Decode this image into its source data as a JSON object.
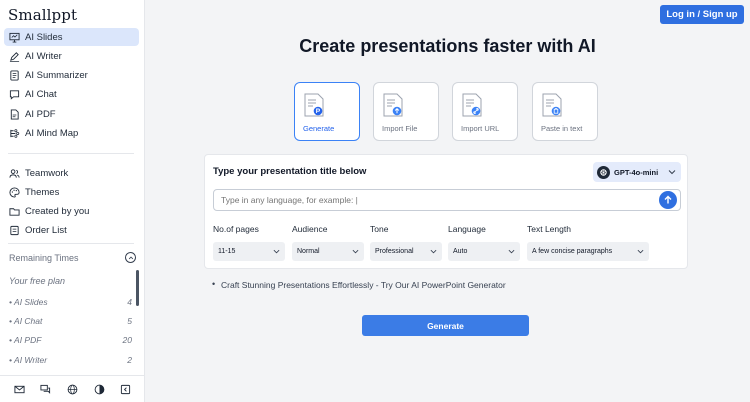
{
  "sidebar": {
    "logo": "Smallppt",
    "nav": [
      {
        "label": "AI Slides",
        "icon": "presentation-icon",
        "active": true
      },
      {
        "label": "AI Writer",
        "icon": "pen-icon"
      },
      {
        "label": "AI Summarizer",
        "icon": "document-icon"
      },
      {
        "label": "AI Chat",
        "icon": "chat-icon"
      },
      {
        "label": "AI PDF",
        "icon": "pdf-icon"
      },
      {
        "label": "AI Mind Map",
        "icon": "mindmap-icon"
      }
    ],
    "nav2": [
      {
        "label": "Teamwork",
        "icon": "team-icon"
      },
      {
        "label": "Themes",
        "icon": "palette-icon"
      },
      {
        "label": "Created by you",
        "icon": "folder-icon"
      },
      {
        "label": "Order List",
        "icon": "receipt-icon"
      }
    ],
    "remaining_label": "Remaining Times",
    "free_plan": "Your free plan",
    "quotas": [
      {
        "label": "• AI Slides",
        "count": "4"
      },
      {
        "label": "• AI Chat",
        "count": "5"
      },
      {
        "label": "• AI PDF",
        "count": "20"
      },
      {
        "label": "• AI Writer",
        "count": "2"
      }
    ],
    "bottom_icons": [
      "mail-icon",
      "chat-bubbles-icon",
      "globe-icon",
      "contrast-icon",
      "collapse-sidebar-icon"
    ]
  },
  "header": {
    "login_label": "Log in / Sign up"
  },
  "main": {
    "headline": "Create presentations faster with AI",
    "modes": [
      {
        "label": "Generate",
        "active": true,
        "badge_color": "#2563eb"
      },
      {
        "label": "Import File",
        "badge_color": "#3b82f6"
      },
      {
        "label": "Import URL",
        "badge_color": "#3b82f6"
      },
      {
        "label": "Paste in text",
        "badge_color": "#3b82f6"
      }
    ],
    "panel": {
      "title": "Type your presentation title below",
      "model": "GPT-4o-mini",
      "input_placeholder": "Type in any language, for example: |",
      "options": [
        {
          "label": "No.of pages",
          "value": "11-15"
        },
        {
          "label": "Audience",
          "value": "Normal"
        },
        {
          "label": "Tone",
          "value": "Professional"
        },
        {
          "label": "Language",
          "value": "Auto"
        },
        {
          "label": "Text Length",
          "value": "A few concise paragraphs"
        }
      ]
    },
    "promo": "Craft Stunning Presentations Effortlessly - Try Our AI PowerPoint Generator",
    "generate_label": "Generate"
  },
  "colors": {
    "accent": "#2f6fe0",
    "active_nav_bg": "#dbe6fb"
  }
}
